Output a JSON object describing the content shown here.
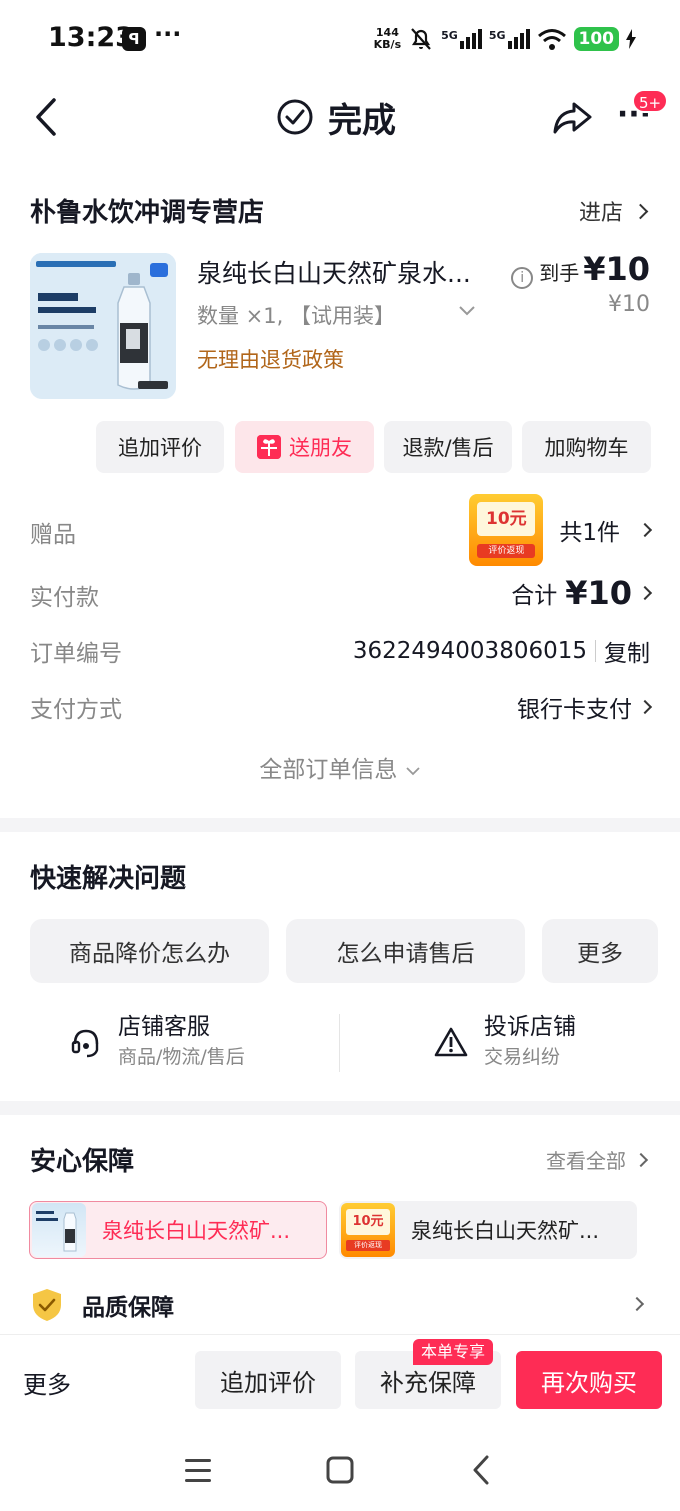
{
  "status_bar": {
    "time": "13:23",
    "app_glyph": "ꟼ",
    "more": "···",
    "net_speed_value": "144",
    "net_speed_unit": "KB/s",
    "signal1_label": "5G",
    "signal2_label": "5G",
    "battery": "100",
    "icons": [
      "mute-icon",
      "signal-icon",
      "signal-icon",
      "wifi-icon",
      "charging-icon"
    ]
  },
  "nav": {
    "title": "完成",
    "badge": "5+",
    "icons": [
      "back-icon",
      "check-circle-icon",
      "share-icon",
      "more-icon"
    ]
  },
  "store": {
    "name": "朴鲁水饮冲调专营店",
    "enter_label": "进店"
  },
  "product": {
    "title": "泉纯长白山天然矿泉水...",
    "price_label": "到手",
    "price": "¥10",
    "original_price": "¥10",
    "spec": "数量 ×1, 【试用装】",
    "policy": "无理由退货政策"
  },
  "actions": {
    "review": "追加评价",
    "gift_friend": "送朋友",
    "refund": "退款/售后",
    "add_cart": "加购物车"
  },
  "order_info": {
    "gift_label": "赠品",
    "gift_count": "共1件",
    "gift_thumb_amount": "10元",
    "gift_thumb_caption": "评价返现",
    "paid_label": "实付款",
    "paid_prefix": "合计",
    "paid_amount": "¥10",
    "order_no_label": "订单编号",
    "order_no": "3622494003806015",
    "copy_label": "复制",
    "pay_method_label": "支付方式",
    "pay_method": "银行卡支付",
    "all_info": "全部订单信息"
  },
  "quick_solve": {
    "title": "快速解决问题",
    "pills": [
      "商品降价怎么办",
      "怎么申请售后",
      "更多"
    ],
    "service_title": "店铺客服",
    "service_sub": "商品/物流/售后",
    "complaint_title": "投诉店铺",
    "complaint_sub": "交易纠纷"
  },
  "guarantee": {
    "title": "安心保障",
    "see_all": "查看全部",
    "card1": "泉纯长白山天然矿...",
    "card2": "泉纯长白山天然矿...",
    "quality": "品质保障"
  },
  "bottom_bar": {
    "more": "更多",
    "review": "追加评价",
    "supplement": "补充保障",
    "supplement_tag": "本单专享",
    "rebuy": "再次购买"
  },
  "colors": {
    "accent": "#fe2c55",
    "policy": "#b1661a",
    "muted": "#888888",
    "surface": "#f2f2f4"
  }
}
